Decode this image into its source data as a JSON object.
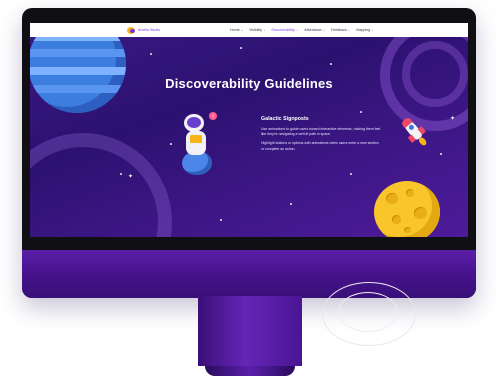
{
  "site": {
    "logo_text": "Artvilla Studio",
    "logo_icon": "moon-logo-icon"
  },
  "nav": [
    {
      "label": "Home",
      "active": false
    },
    {
      "label": "Visibility",
      "active": false
    },
    {
      "label": "Discoverability",
      "active": true
    },
    {
      "label": "Affordance",
      "active": false
    },
    {
      "label": "Feedback",
      "active": false
    },
    {
      "label": "Mapping",
      "active": false
    }
  ],
  "hero": {
    "title": "Discoverability Guidelines"
  },
  "section": {
    "heading": "Galactic Signposts",
    "paragraph_1": "Use animations to guide users toward interactive elements, making them feel like they're navigating a well-lit path in space.",
    "paragraph_2": "Highlight buttons or options with animations when users enter a new section or complete an action."
  },
  "colors": {
    "accent": "#8a3be6",
    "background": "#2c1170",
    "moon": "#f8c52a",
    "planet": "#3c7de0"
  }
}
